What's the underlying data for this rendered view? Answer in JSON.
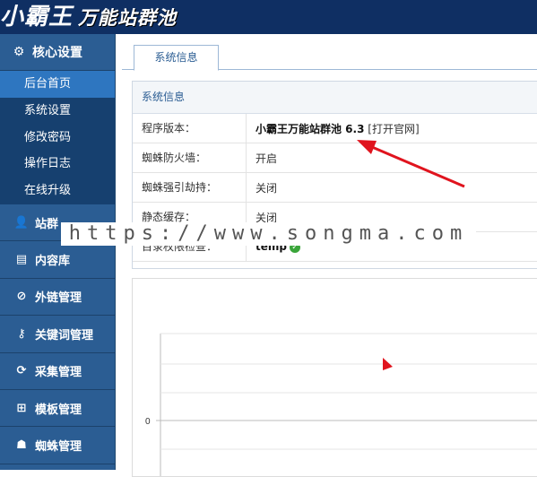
{
  "header": {
    "logo_main": "小霸王",
    "logo_sub": "万能站群池"
  },
  "sidebar": {
    "section_title": "核心设置",
    "sub_items": [
      {
        "label": "后台首页",
        "active": true
      },
      {
        "label": "系统设置"
      },
      {
        "label": "修改密码"
      },
      {
        "label": "操作日志"
      },
      {
        "label": "在线升级"
      }
    ],
    "categories": [
      {
        "label": "站群",
        "icon": "user-icon"
      },
      {
        "label": "内容库",
        "icon": "document-icon"
      },
      {
        "label": "外链管理",
        "icon": "link-icon"
      },
      {
        "label": "关键词管理",
        "icon": "key-icon"
      },
      {
        "label": "采集管理",
        "icon": "refresh-icon"
      },
      {
        "label": "模板管理",
        "icon": "windows-icon"
      },
      {
        "label": "蜘蛛管理",
        "icon": "android-icon"
      }
    ]
  },
  "main": {
    "tab_label": "系统信息",
    "panel_title": "系统信息",
    "rows": [
      {
        "label": "程序版本：",
        "value": "小霸王万能站群池 6.3",
        "link": "[打开官网]"
      },
      {
        "label": "蜘蛛防火墙：",
        "value": "开启"
      },
      {
        "label": "蜘蛛强引劫持：",
        "value": "关闭"
      },
      {
        "label": "静态缓存：",
        "value": "关闭"
      },
      {
        "label": "目录权限检查：",
        "value": "temp"
      }
    ]
  },
  "chart_data": {
    "type": "line",
    "ytick_labels": [
      "0"
    ],
    "values": []
  },
  "watermark": "https://www.songma.com",
  "colors": {
    "header_bg": "#0f2f63",
    "sidebar_bg": "#2b5d93",
    "active_item": "#2e76c0",
    "arrow": "#e0141e"
  }
}
